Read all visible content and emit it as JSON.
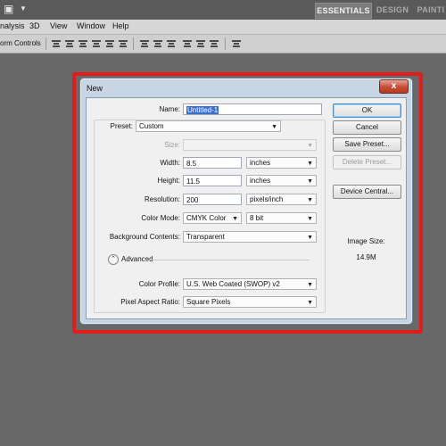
{
  "app": {
    "workspaces": [
      "ESSENTIALS",
      "DESIGN",
      "PAINTI"
    ],
    "menu": [
      "nalysis",
      "3D",
      "View",
      "Window",
      "Help"
    ],
    "options_label": "orm Controls"
  },
  "dialog": {
    "title": "New",
    "close": "x",
    "name_label": "Name:",
    "name_value": "Untitled-1",
    "preset_label": "Preset:",
    "preset_value": "Custom",
    "size_label": "Size:",
    "size_value": "",
    "width_label": "Width:",
    "width_value": "8.5",
    "width_unit": "inches",
    "height_label": "Height:",
    "height_value": "11.5",
    "height_unit": "inches",
    "resolution_label": "Resolution:",
    "resolution_value": "200",
    "resolution_unit": "pixels/inch",
    "color_mode_label": "Color Mode:",
    "color_mode_value": "CMYK Color",
    "bit_depth_value": "8 bit",
    "background_label": "Background Contents:",
    "background_value": "Transparent",
    "advanced_label": "Advanced",
    "color_profile_label": "Color Profile:",
    "color_profile_value": "U.S. Web Coated (SWOP) v2",
    "pixel_aspect_label": "Pixel Aspect Ratio:",
    "pixel_aspect_value": "Square Pixels",
    "buttons": {
      "ok": "OK",
      "cancel": "Cancel",
      "save_preset": "Save Preset...",
      "delete_preset": "Delete Preset...",
      "device_central": "Device Central..."
    },
    "image_size_label": "Image Size:",
    "image_size_value": "14.9M"
  },
  "colors": {
    "highlight_frame": "#e21b1b",
    "app_background": "#686868"
  }
}
